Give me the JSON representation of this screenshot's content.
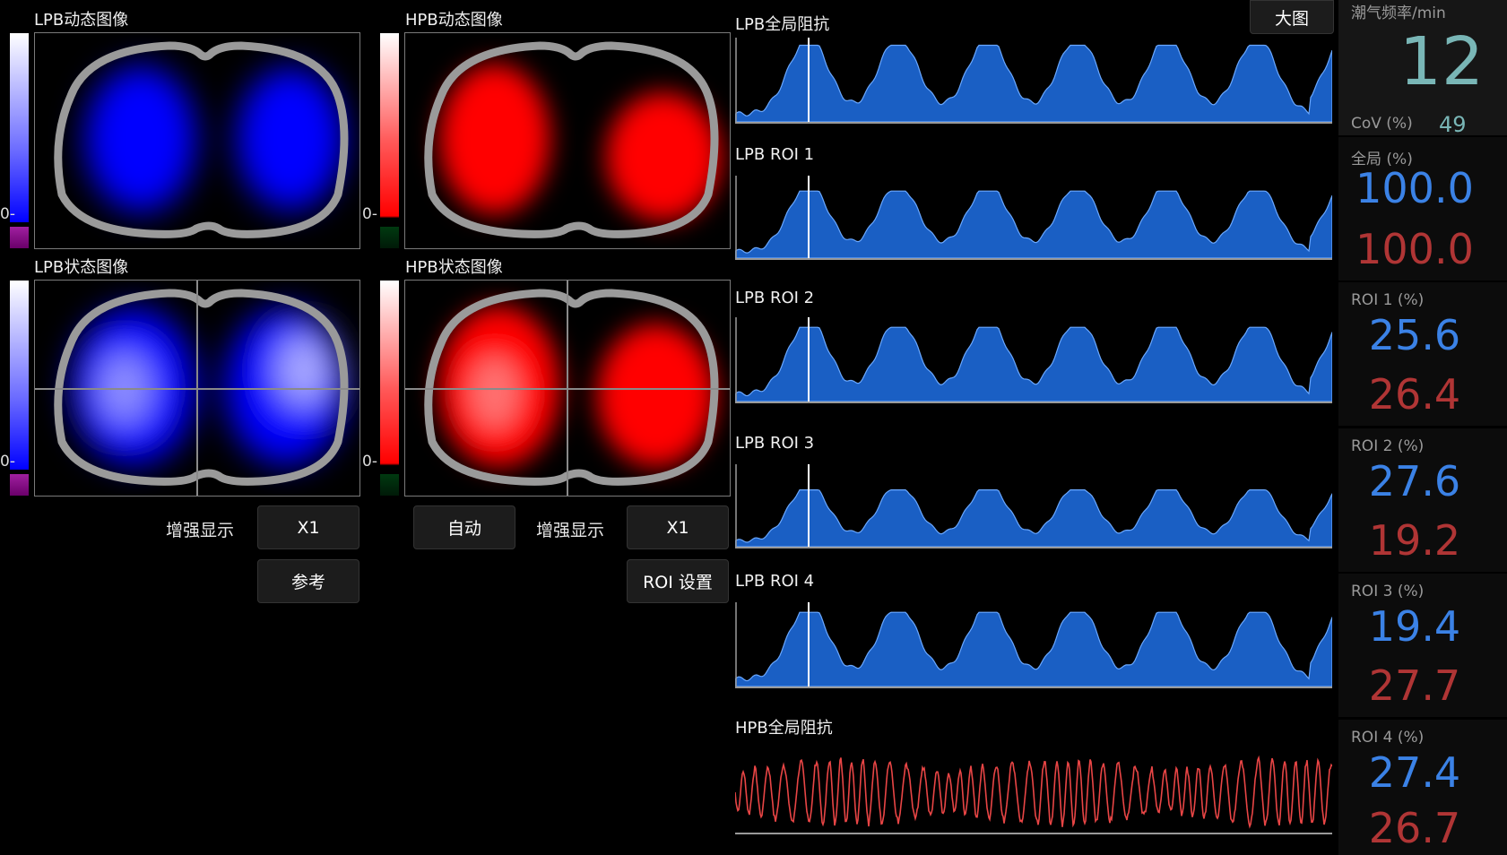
{
  "panels": {
    "lpb_dynamic_title": "LPB动态图像",
    "hpb_dynamic_title": "HPB动态图像",
    "lpb_state_title": "LPB状态图像",
    "hpb_state_title": "HPB状态图像",
    "zero_label": "0-",
    "colors": {
      "lpb": "#0000ff",
      "hpb": "#ff0000"
    }
  },
  "controls": {
    "enhance_label_left": "增强显示",
    "x1_left": "X1",
    "reference": "参考",
    "auto": "自动",
    "enhance_label_right": "增强显示",
    "x1_right": "X1",
    "roi_settings": "ROI 设置",
    "large_view": "大图"
  },
  "waveforms": {
    "lpb_global": "LPB全局阻抗",
    "lpb_roi1": "LPB ROI 1",
    "lpb_roi2": "LPB ROI 2",
    "lpb_roi3": "LPB ROI 3",
    "lpb_roi4": "LPB ROI 4",
    "hpb_global": "HPB全局阻抗",
    "lpb_color": "#1a5fc4",
    "hpb_color": "#e84545"
  },
  "metrics": {
    "resp_rate_label": "潮气频率/min",
    "resp_rate": "12",
    "cov_label": "CoV (%)",
    "cov_value": "49",
    "global_label": "全局 (%)",
    "global_blue": "100.0",
    "global_red": "100.0",
    "roi1_label": "ROI 1 (%)",
    "roi1_blue": "25.6",
    "roi1_red": "26.4",
    "roi2_label": "ROI 2 (%)",
    "roi2_blue": "27.6",
    "roi2_red": "19.2",
    "roi3_label": "ROI 3 (%)",
    "roi3_blue": "19.4",
    "roi3_red": "27.7",
    "roi4_label": "ROI 4 (%)",
    "roi4_blue": "27.4",
    "roi4_red": "26.7"
  }
}
